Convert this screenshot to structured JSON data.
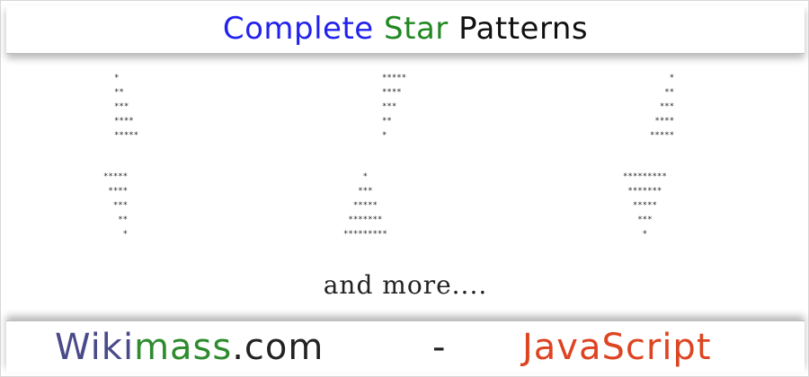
{
  "header": {
    "title_part1": "Complete",
    "title_part2": "Star",
    "title_part3": "Patterns",
    "colors": {
      "part1": "#2222ee",
      "part2": "#228822",
      "part3": "#111111"
    }
  },
  "patterns": [
    {
      "rows": [
        "*",
        "**",
        "***",
        "****",
        "*****"
      ]
    },
    {
      "rows": [
        "*****",
        "****",
        "***",
        "**",
        "*"
      ]
    },
    {
      "rows": [
        "    *",
        "   **",
        "  ***",
        " ****",
        "*****"
      ]
    },
    {
      "rows": [
        "*****",
        " ****",
        "  ***",
        "   **",
        "    *"
      ]
    },
    {
      "rows": [
        "    *",
        "   ***",
        "  *****",
        " *******",
        "*********"
      ]
    },
    {
      "rows": [
        "*********",
        " *******",
        "  *****",
        "   ***",
        "    *"
      ]
    }
  ],
  "note": "and more....",
  "footer": {
    "brand_part1": "Wiki",
    "brand_part2": "mass",
    "brand_part3": ".com",
    "separator": "-",
    "language": "JavaScript",
    "colors": {
      "brand1": "#4a4a8a",
      "brand2": "#2e8b2e",
      "brand3": "#222222",
      "language": "#dd4422"
    }
  }
}
